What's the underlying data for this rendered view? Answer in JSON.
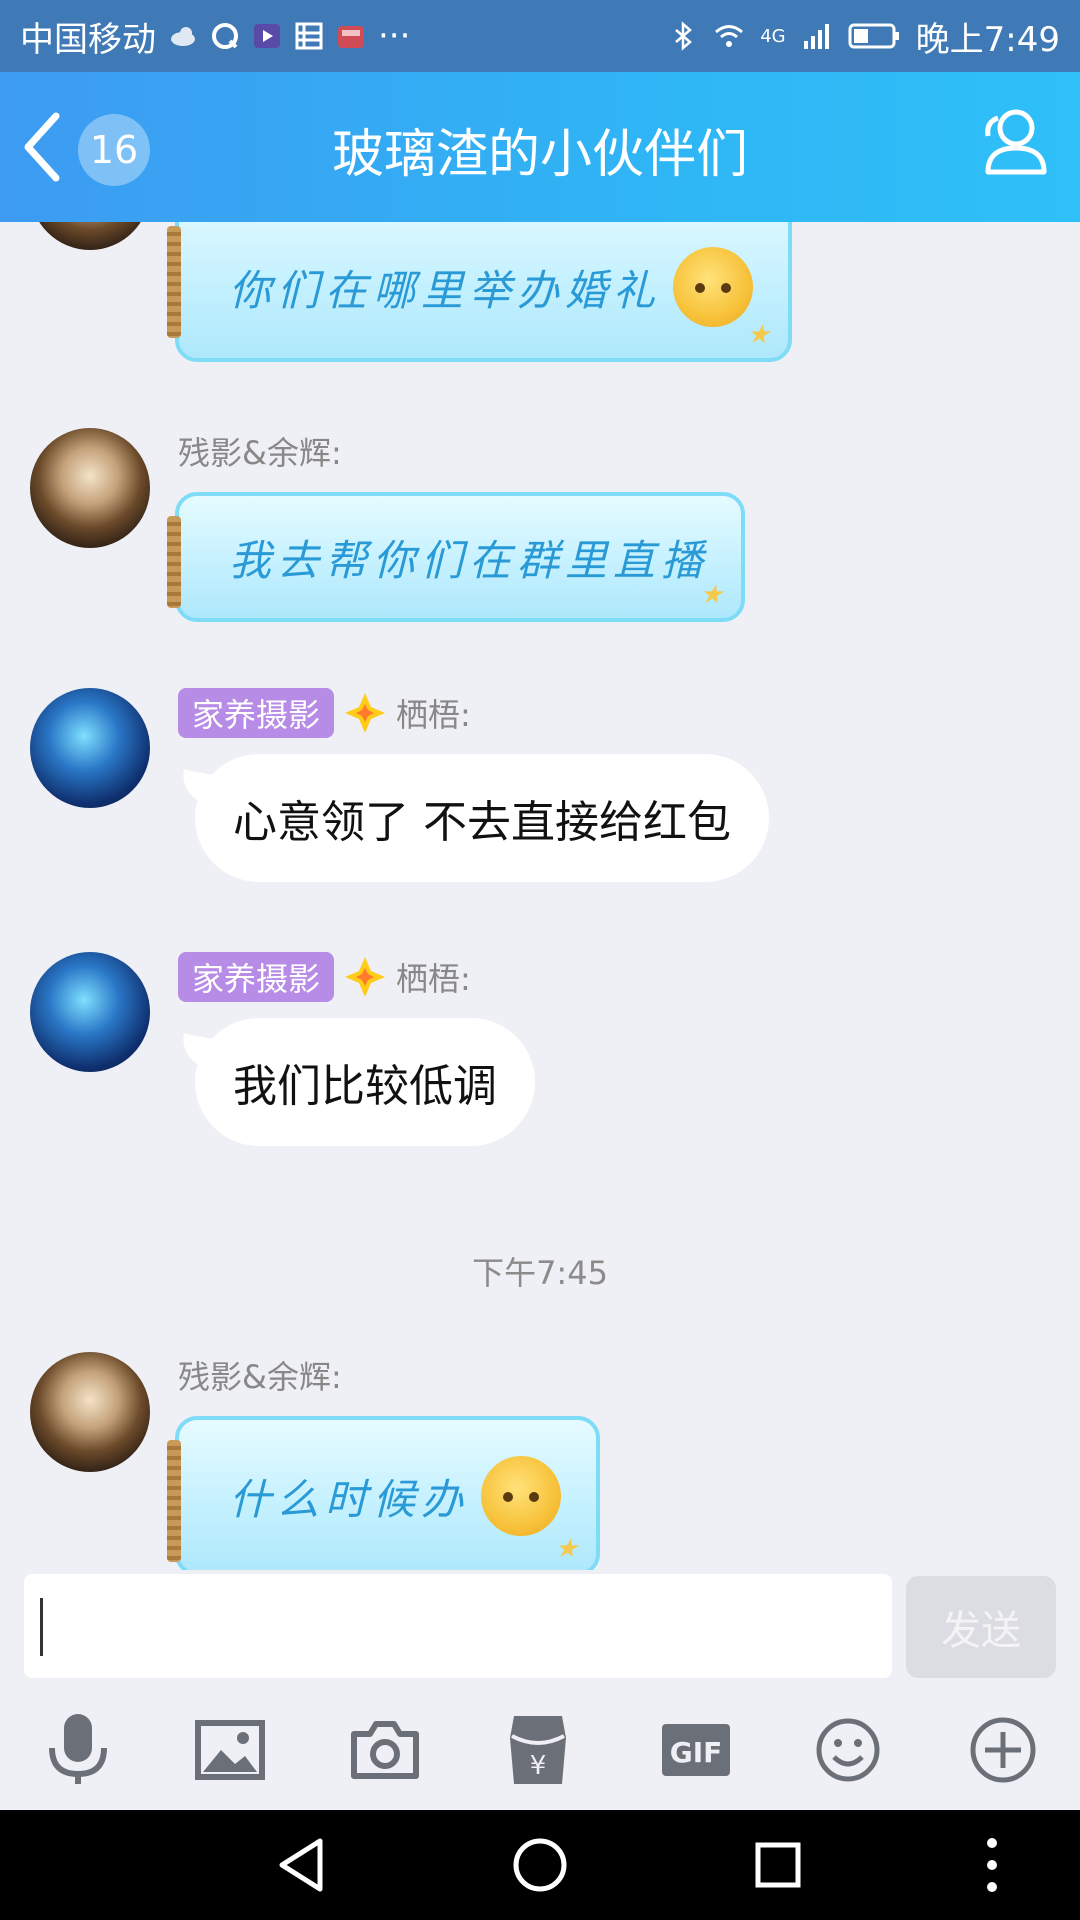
{
  "status_bar": {
    "carrier": "中国移动",
    "network": "4G",
    "time": "晚上7:49"
  },
  "header": {
    "unread_count": "16",
    "title": "玻璃渣的小伙伴们"
  },
  "messages": [
    {
      "sender": "",
      "text": "你们在哪里举办婚礼",
      "style": "bottle",
      "has_emoji": true
    },
    {
      "sender": "残影&余辉:",
      "text": "我去帮你们在群里直播",
      "style": "bottle",
      "has_emoji": false
    },
    {
      "tag": "家养摄影",
      "sender": "栖梧:",
      "text": "心意领了 不去直接给红包",
      "style": "plain"
    },
    {
      "tag": "家养摄影",
      "sender": "栖梧:",
      "text": "我们比较低调",
      "style": "plain"
    },
    {
      "sender": "残影&余辉:",
      "text": "什么时候办",
      "style": "bottle",
      "has_emoji": true
    }
  ],
  "timestamp": "下午7:45",
  "input": {
    "value": "",
    "send_label": "发送"
  },
  "tools": [
    {
      "icon": "microphone-icon"
    },
    {
      "icon": "image-icon"
    },
    {
      "icon": "camera-icon"
    },
    {
      "icon": "red-packet-icon"
    },
    {
      "icon": "gif-icon",
      "label": "GIF"
    },
    {
      "icon": "emoji-icon"
    },
    {
      "icon": "plus-icon"
    }
  ],
  "colors": {
    "header_start": "#3d9bf2",
    "header_end": "#2fc0f8",
    "status_bar": "#3f7ab6",
    "chat_bg": "#eff0f5",
    "tag_purple": "#b78ce6",
    "bottle_text": "#2a9ad6"
  }
}
